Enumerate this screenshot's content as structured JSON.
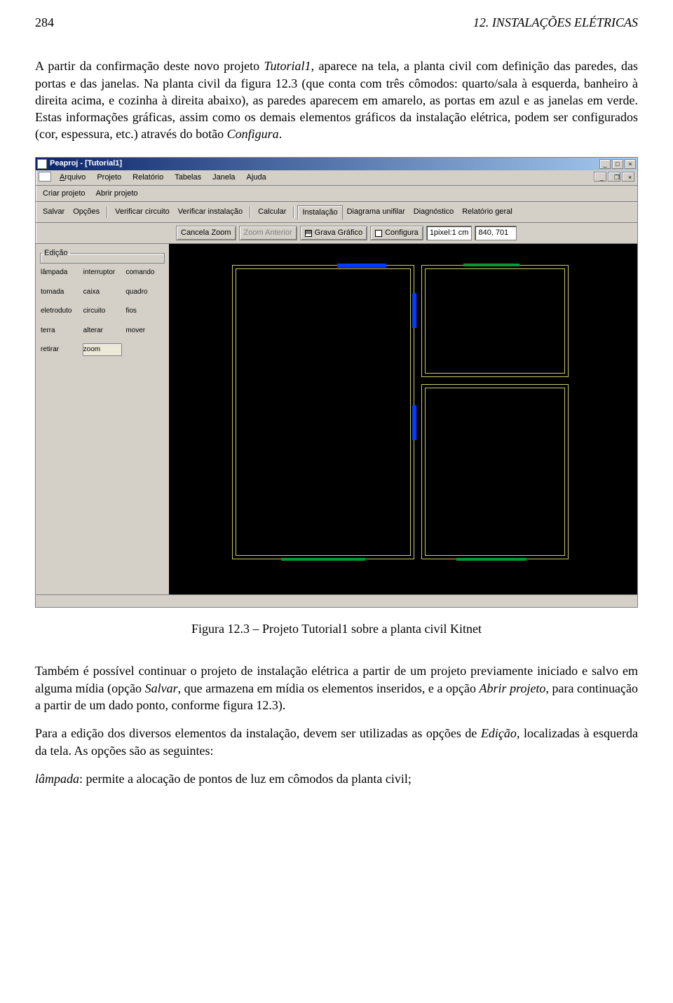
{
  "page": {
    "number": "284",
    "chapter": "12. INSTALAÇÕES ELÉTRICAS",
    "para1_pre": "A partir da confirmação deste novo projeto ",
    "para1_it1": "Tutorial1",
    "para1_mid": ", aparece na tela, a planta civil com definição das paredes, das portas e das janelas. Na planta civil da figura 12.3 (que conta com três cômodos: quarto/sala à esquerda, banheiro à direita acima, e cozinha à direita abaixo), as paredes aparecem em amarelo, as portas em azul e as janelas em verde. Estas informações gráficas, assim como os demais elementos gráficos da instalação elétrica, podem ser configurados (cor, espessura, etc.) através do botão ",
    "para1_it2": "Configura",
    "para1_end": ".",
    "caption": "Figura 12.3 – Projeto Tutorial1 sobre a planta civil Kitnet",
    "para2_pre": "Também é possível continuar o projeto de instalação elétrica a partir de um projeto previamente iniciado e salvo em alguma mídia (opção ",
    "para2_it1": "Salvar",
    "para2_mid1": ", que armazena em mídia os elementos inseridos, e a opção ",
    "para2_it2": "Abrir projeto",
    "para2_mid2": ", para continuação a partir de um dado ponto, conforme figura 12.3).",
    "para3_pre": "Para a edição dos diversos elementos da instalação, devem ser utilizadas as opções de ",
    "para3_it1": "Edição",
    "para3_mid": ", localizadas à esquerda da tela. As opções são as seguintes:",
    "para4_pre": "lâmpada",
    "para4_txt": ": permite a alocação de pontos de luz em cômodos da planta civil;"
  },
  "app": {
    "title": "Peaproj - [Tutorial1]",
    "menubar": {
      "arquivo": "Arquivo",
      "projeto": "Projeto",
      "relatorio": "Relatório",
      "tabelas": "Tabelas",
      "janela": "Janela",
      "ajuda": "Ajuda"
    },
    "toolbar1": {
      "criar": "Criar projeto",
      "abrir": "Abrir projeto"
    },
    "toolbar2": {
      "salvar": "Salvar",
      "opcoes": "Opções",
      "verifcirc": "Verificar circuito",
      "verifinst": "Verificar instalação",
      "calcular": "Calcular",
      "tab_inst": "Instalação",
      "tab_diag": "Diagrama unifilar",
      "tab_dgn": "Diagnóstico",
      "tab_rel": "Relatório geral"
    },
    "toolbar3": {
      "cancela": "Cancela Zoom",
      "anterior": "Zoom Anterior",
      "grava": "Grava Gráfico",
      "configura": "Configura",
      "scale": "1pixel:1 cm",
      "coords": "840, 701"
    },
    "side": {
      "legend": "Edição",
      "items": [
        "lâmpada",
        "interruptor",
        "comando",
        "tomada",
        "caixa",
        "quadro",
        "eletroduto",
        "circuito",
        "fios",
        "terra",
        "alterar",
        "mover",
        "retirar",
        "zoom"
      ],
      "selected_index": 13
    }
  }
}
